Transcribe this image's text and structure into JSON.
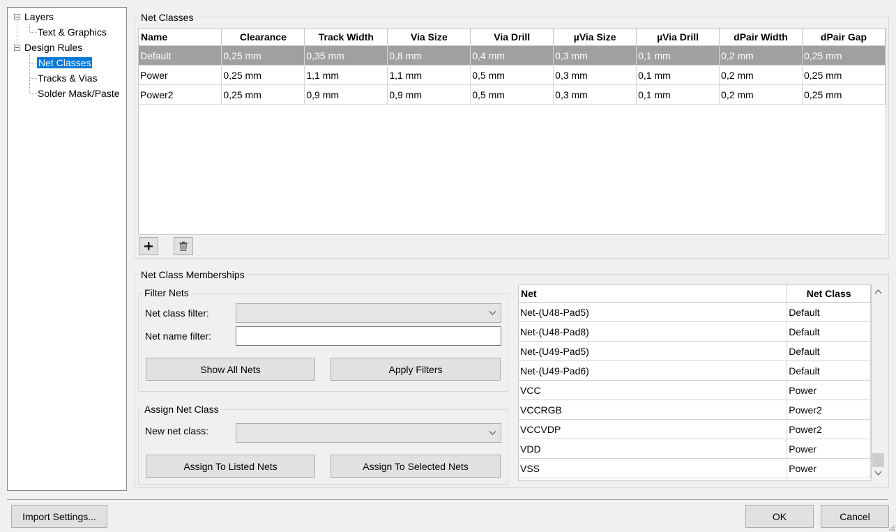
{
  "tree": {
    "items": [
      {
        "label": "Layers"
      },
      {
        "label": "Text & Graphics"
      },
      {
        "label": "Design Rules"
      },
      {
        "label": "Net Classes"
      },
      {
        "label": "Tracks & Vias"
      },
      {
        "label": "Solder Mask/Paste"
      }
    ]
  },
  "net_classes": {
    "title": "Net Classes",
    "columns": [
      "Name",
      "Clearance",
      "Track Width",
      "Via Size",
      "Via Drill",
      "µVia Size",
      "µVia Drill",
      "dPair Width",
      "dPair Gap"
    ],
    "rows": [
      [
        "Default",
        "0,25 mm",
        "0,35 mm",
        "0,8 mm",
        "0,4 mm",
        "0,3 mm",
        "0,1 mm",
        "0,2 mm",
        "0,25 mm"
      ],
      [
        "Power",
        "0,25 mm",
        "1,1 mm",
        "1,1 mm",
        "0,5 mm",
        "0,3 mm",
        "0,1 mm",
        "0,2 mm",
        "0,25 mm"
      ],
      [
        "Power2",
        "0,25 mm",
        "0,9 mm",
        "0,9 mm",
        "0,5 mm",
        "0,3 mm",
        "0,1 mm",
        "0,2 mm",
        "0,25 mm"
      ]
    ],
    "selected_row": 0,
    "add_icon": "plus-icon",
    "delete_icon": "trash-icon"
  },
  "memberships": {
    "title": "Net Class Memberships",
    "filter": {
      "title": "Filter Nets",
      "class_label": "Net class filter:",
      "class_value": "",
      "name_label": "Net name filter:",
      "name_value": "",
      "show_all": "Show All Nets",
      "apply": "Apply Filters"
    },
    "assign": {
      "title": "Assign Net Class",
      "new_label": "New net class:",
      "new_value": "",
      "listed": "Assign To Listed Nets",
      "selected": "Assign To Selected Nets"
    },
    "list": {
      "columns": [
        "Net",
        "Net Class"
      ],
      "rows": [
        [
          "Net-(U48-Pad5)",
          "Default"
        ],
        [
          "Net-(U48-Pad8)",
          "Default"
        ],
        [
          "Net-(U49-Pad5)",
          "Default"
        ],
        [
          "Net-(U49-Pad6)",
          "Default"
        ],
        [
          "VCC",
          "Power"
        ],
        [
          "VCCRGB",
          "Power2"
        ],
        [
          "VCCVDP",
          "Power2"
        ],
        [
          "VDD",
          "Power"
        ],
        [
          "VSS",
          "Power"
        ]
      ]
    }
  },
  "footer": {
    "import": "Import Settings...",
    "ok": "OK",
    "cancel": "Cancel"
  },
  "colors": {
    "selection": "#0078d7",
    "grid_selected_row": "#a0a0a0",
    "dialog_bg": "#f0f0f0"
  }
}
